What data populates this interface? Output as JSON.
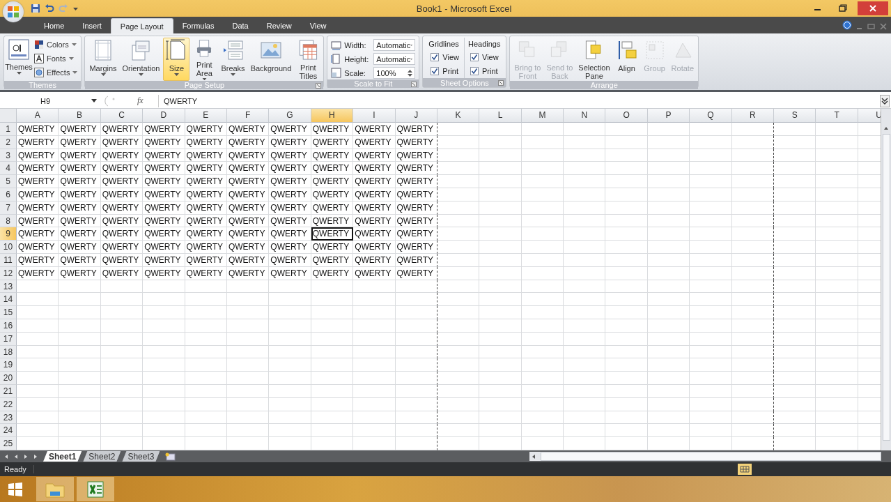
{
  "window": {
    "title": "Book1 - Microsoft Excel"
  },
  "ribbon_tabs": [
    {
      "label": "Home",
      "selected": false
    },
    {
      "label": "Insert",
      "selected": false
    },
    {
      "label": "Page Layout",
      "selected": true
    },
    {
      "label": "Formulas",
      "selected": false
    },
    {
      "label": "Data",
      "selected": false
    },
    {
      "label": "Review",
      "selected": false
    },
    {
      "label": "View",
      "selected": false
    }
  ],
  "ribbon": {
    "themes": {
      "title": "Themes",
      "main": "Themes",
      "items": [
        "Colors",
        "Fonts",
        "Effects"
      ]
    },
    "page_setup": {
      "title": "Page Setup",
      "buttons": [
        {
          "lines": [
            "Margins"
          ],
          "highlighted": false
        },
        {
          "lines": [
            "Orientation"
          ],
          "highlighted": false
        },
        {
          "lines": [
            "Size"
          ],
          "highlighted": true
        },
        {
          "lines": [
            "Print",
            "Area"
          ],
          "highlighted": false
        },
        {
          "lines": [
            "Breaks"
          ],
          "highlighted": false
        },
        {
          "lines": [
            "Background"
          ],
          "highlighted": false
        },
        {
          "lines": [
            "Print",
            "Titles"
          ],
          "highlighted": false
        }
      ]
    },
    "scale_to_fit": {
      "title": "Scale to Fit",
      "fields": [
        {
          "label": "Width:",
          "value": "Automatic",
          "kind": "dropdown"
        },
        {
          "label": "Height:",
          "value": "Automatic",
          "kind": "dropdown"
        },
        {
          "label": "Scale:",
          "value": "100%",
          "kind": "spinner"
        }
      ]
    },
    "sheet_options": {
      "title": "Sheet Options",
      "columns": [
        {
          "heading": "Gridlines",
          "options": [
            {
              "label": "View",
              "checked": true
            },
            {
              "label": "Print",
              "checked": true
            }
          ]
        },
        {
          "heading": "Headings",
          "options": [
            {
              "label": "View",
              "checked": true
            },
            {
              "label": "Print",
              "checked": true
            }
          ]
        }
      ]
    },
    "arrange": {
      "title": "Arrange",
      "buttons": [
        {
          "lines": [
            "Bring to",
            "Front"
          ],
          "disabled": true
        },
        {
          "lines": [
            "Send to",
            "Back"
          ],
          "disabled": true
        },
        {
          "lines": [
            "Selection",
            "Pane"
          ],
          "disabled": false
        },
        {
          "lines": [
            "Align"
          ],
          "disabled": false
        },
        {
          "lines": [
            "Group"
          ],
          "disabled": true
        },
        {
          "lines": [
            "Rotate"
          ],
          "disabled": true
        }
      ]
    }
  },
  "formula_bar": {
    "name_box": "H9",
    "fx_label": "fx",
    "formula": "QWERTY"
  },
  "sheet": {
    "columns": [
      {
        "label": "A",
        "selected": false,
        "page_break": false
      },
      {
        "label": "B",
        "selected": false,
        "page_break": false
      },
      {
        "label": "C",
        "selected": false,
        "page_break": false
      },
      {
        "label": "D",
        "selected": false,
        "page_break": false
      },
      {
        "label": "E",
        "selected": false,
        "page_break": false
      },
      {
        "label": "F",
        "selected": false,
        "page_break": false
      },
      {
        "label": "G",
        "selected": false,
        "page_break": false
      },
      {
        "label": "H",
        "selected": true,
        "page_break": false
      },
      {
        "label": "I",
        "selected": false,
        "page_break": false
      },
      {
        "label": "J",
        "selected": false,
        "page_break": true
      },
      {
        "label": "K",
        "selected": false,
        "page_break": false
      },
      {
        "label": "L",
        "selected": false,
        "page_break": false
      },
      {
        "label": "M",
        "selected": false,
        "page_break": false
      },
      {
        "label": "N",
        "selected": false,
        "page_break": false
      },
      {
        "label": "O",
        "selected": false,
        "page_break": false
      },
      {
        "label": "P",
        "selected": false,
        "page_break": false
      },
      {
        "label": "Q",
        "selected": false,
        "page_break": false
      },
      {
        "label": "R",
        "selected": false,
        "page_break": true
      },
      {
        "label": "S",
        "selected": false,
        "page_break": false
      },
      {
        "label": "T",
        "selected": false,
        "page_break": false
      },
      {
        "label": "U",
        "selected": false,
        "page_break": false
      }
    ],
    "rows": [
      {
        "label": "1",
        "selected": false,
        "cells": [
          "QWERTY",
          "QWERTY",
          "QWERTY",
          "QWERTY",
          "QWERTY",
          "QWERTY",
          "QWERTY",
          "QWERTY",
          "QWERTY",
          "QWERTY"
        ]
      },
      {
        "label": "2",
        "selected": false,
        "cells": [
          "QWERTY",
          "QWERTY",
          "QWERTY",
          "QWERTY",
          "QWERTY",
          "QWERTY",
          "QWERTY",
          "QWERTY",
          "QWERTY",
          "QWERTY"
        ]
      },
      {
        "label": "3",
        "selected": false,
        "cells": [
          "QWERTY",
          "QWERTY",
          "QWERTY",
          "QWERTY",
          "QWERTY",
          "QWERTY",
          "QWERTY",
          "QWERTY",
          "QWERTY",
          "QWERTY"
        ]
      },
      {
        "label": "4",
        "selected": false,
        "cells": [
          "QWERTY",
          "QWERTY",
          "QWERTY",
          "QWERTY",
          "QWERTY",
          "QWERTY",
          "QWERTY",
          "QWERTY",
          "QWERTY",
          "QWERTY"
        ]
      },
      {
        "label": "5",
        "selected": false,
        "cells": [
          "QWERTY",
          "QWERTY",
          "QWERTY",
          "QWERTY",
          "QWERTY",
          "QWERTY",
          "QWERTY",
          "QWERTY",
          "QWERTY",
          "QWERTY"
        ]
      },
      {
        "label": "6",
        "selected": false,
        "cells": [
          "QWERTY",
          "QWERTY",
          "QWERTY",
          "QWERTY",
          "QWERTY",
          "QWERTY",
          "QWERTY",
          "QWERTY",
          "QWERTY",
          "QWERTY"
        ]
      },
      {
        "label": "7",
        "selected": false,
        "cells": [
          "QWERTY",
          "QWERTY",
          "QWERTY",
          "QWERTY",
          "QWERTY",
          "QWERTY",
          "QWERTY",
          "QWERTY",
          "QWERTY",
          "QWERTY"
        ]
      },
      {
        "label": "8",
        "selected": false,
        "cells": [
          "QWERTY",
          "QWERTY",
          "QWERTY",
          "QWERTY",
          "QWERTY",
          "QWERTY",
          "QWERTY",
          "QWERTY",
          "QWERTY",
          "QWERTY"
        ]
      },
      {
        "label": "9",
        "selected": true,
        "cells": [
          "QWERTY",
          "QWERTY",
          "QWERTY",
          "QWERTY",
          "QWERTY",
          "QWERTY",
          "QWERTY",
          "QWERTY",
          "QWERTY",
          "QWERTY"
        ]
      },
      {
        "label": "10",
        "selected": false,
        "cells": [
          "QWERTY",
          "QWERTY",
          "QWERTY",
          "QWERTY",
          "QWERTY",
          "QWERTY",
          "QWERTY",
          "QWERTY",
          "QWERTY",
          "QWERTY"
        ]
      },
      {
        "label": "11",
        "selected": false,
        "cells": [
          "QWERTY",
          "QWERTY",
          "QWERTY",
          "QWERTY",
          "QWERTY",
          "QWERTY",
          "QWERTY",
          "QWERTY",
          "QWERTY",
          "QWERTY"
        ]
      },
      {
        "label": "12",
        "selected": false,
        "cells": [
          "QWERTY",
          "QWERTY",
          "QWERTY",
          "QWERTY",
          "QWERTY",
          "QWERTY",
          "QWERTY",
          "QWERTY",
          "QWERTY",
          "QWERTY"
        ]
      },
      {
        "label": "13",
        "selected": false
      },
      {
        "label": "14",
        "selected": false
      },
      {
        "label": "15",
        "selected": false
      },
      {
        "label": "16",
        "selected": false
      },
      {
        "label": "17",
        "selected": false
      },
      {
        "label": "18",
        "selected": false
      },
      {
        "label": "19",
        "selected": false
      },
      {
        "label": "20",
        "selected": false
      },
      {
        "label": "21",
        "selected": false
      },
      {
        "label": "22",
        "selected": false
      },
      {
        "label": "23",
        "selected": false
      },
      {
        "label": "24",
        "selected": false
      },
      {
        "label": "25",
        "selected": false
      }
    ]
  },
  "sheet_tabs": [
    {
      "label": "Sheet1",
      "selected": true
    },
    {
      "label": "Sheet2",
      "selected": false
    },
    {
      "label": "Sheet3",
      "selected": false
    }
  ],
  "status_bar": {
    "text": "Ready"
  }
}
